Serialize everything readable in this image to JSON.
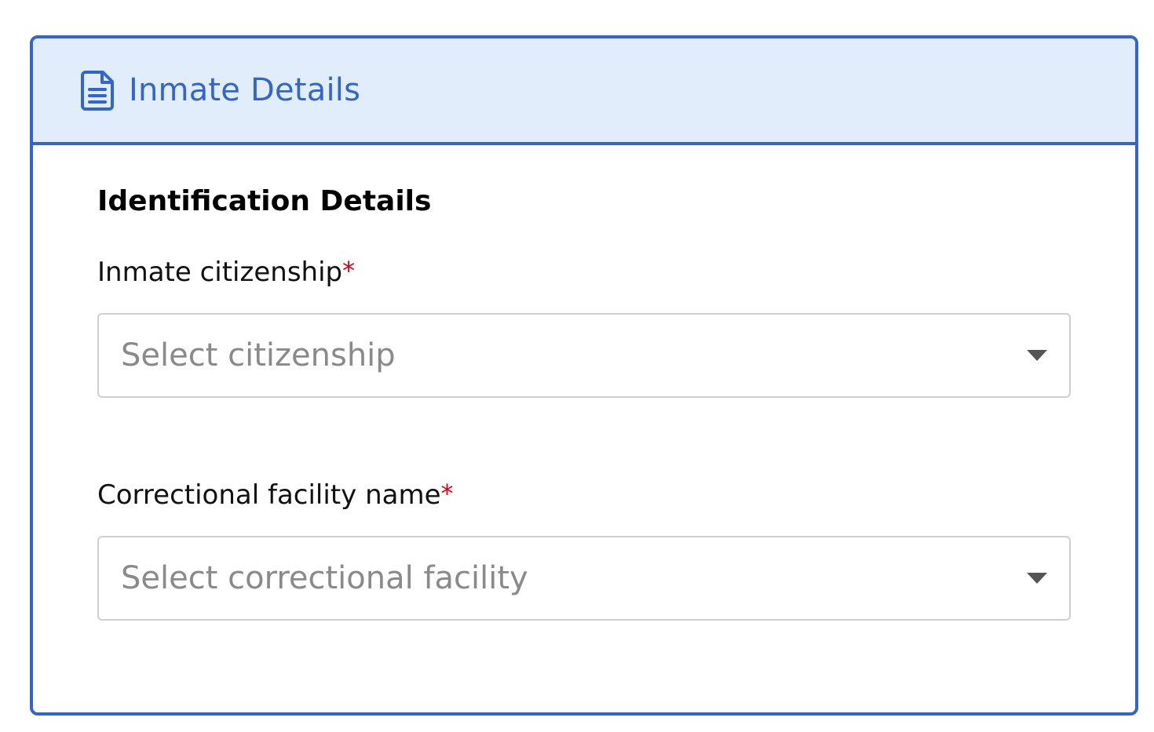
{
  "card": {
    "title": "Inmate Details",
    "title_icon": "document-icon"
  },
  "section": {
    "title": "Identification Details"
  },
  "fields": [
    {
      "label": "Inmate citizenship",
      "required_mark": "*",
      "placeholder": "Select citizenship",
      "icon": "chevron-down-icon"
    },
    {
      "label": "Correctional facility name",
      "required_mark": "*",
      "placeholder": "Select correctional facility",
      "icon": "chevron-down-icon"
    }
  ],
  "colors": {
    "accent": "#3366cc",
    "header_background": "#e1edfa",
    "required": "#d0021b",
    "placeholder": "#8a8a8a"
  }
}
